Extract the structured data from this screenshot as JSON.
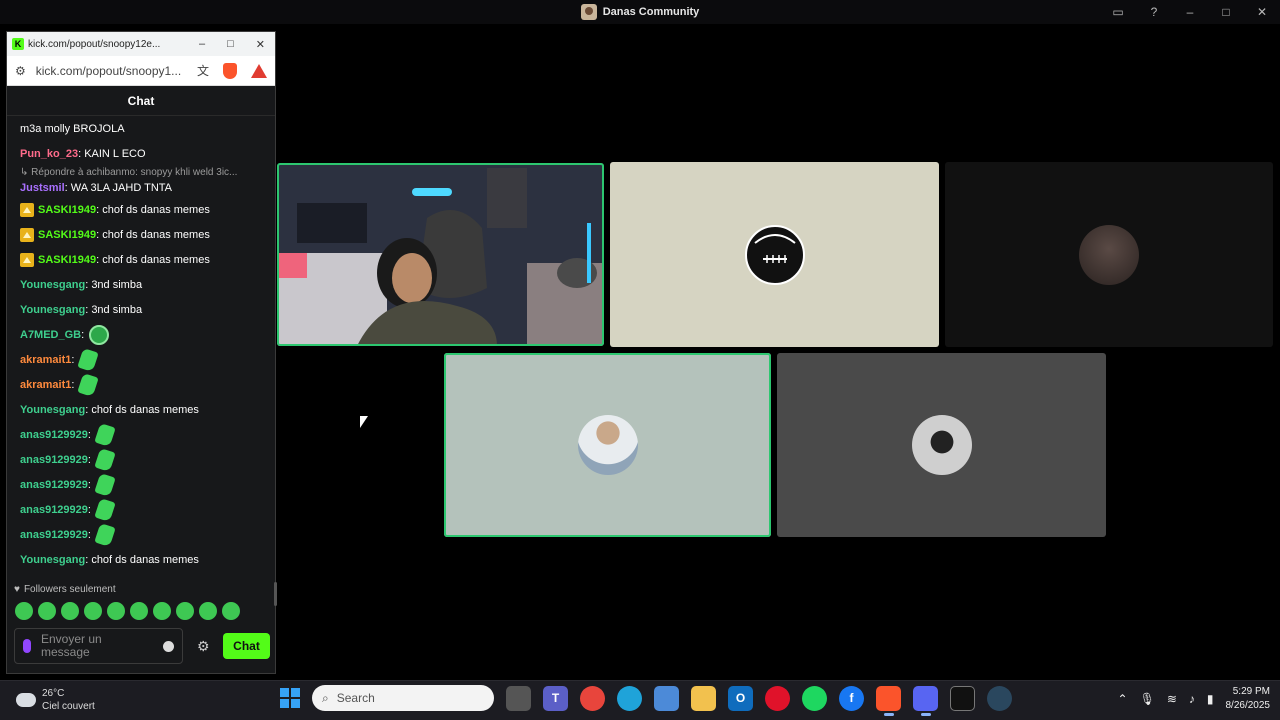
{
  "window": {
    "title": "Danas Community"
  },
  "popout": {
    "title": "kick.com/popout/snoopy12e...",
    "url": "kick.com/popout/snoopy1...",
    "chat_header": "Chat",
    "followers_label": "Followers seulement",
    "input_placeholder_line1": "Envoyer un",
    "input_placeholder_line2": "message",
    "send_label": "Chat"
  },
  "chat": {
    "messages": [
      {
        "user": "",
        "text": "m3a molly BROJOLA",
        "color": "#ffffff"
      },
      {
        "user": "Pun_ko_23",
        "text": ": KAIN L ECO",
        "color": "#ff6b8b"
      },
      {
        "reply": "Répondre à achibanmo: snopyy khli weld 3ic..."
      },
      {
        "user": "Justsmil",
        "text": ": WA 3LA JAHD TNTA",
        "color": "#a970ff"
      },
      {
        "user": "SASKI1949",
        "text": ": chof ds danas memes",
        "color": "#53fc18",
        "crown": true
      },
      {
        "user": "SASKI1949",
        "text": ": chof ds danas memes",
        "color": "#53fc18",
        "crown": true
      },
      {
        "user": "SASKI1949",
        "text": ": chof ds danas memes",
        "color": "#53fc18",
        "crown": true
      },
      {
        "user": "Younesgang",
        "text": ": 3nd simba",
        "color": "#3ecf8e"
      },
      {
        "user": "Younesgang",
        "text": ": 3nd simba",
        "color": "#3ecf8e"
      },
      {
        "user": "A7MED_GB",
        "text": ":",
        "color": "#3ecf8e",
        "emote": "round"
      },
      {
        "user": "akramait1",
        "text": ":",
        "color": "#ff8a3d",
        "emote": "leaf"
      },
      {
        "user": "akramait1",
        "text": ":",
        "color": "#ff8a3d",
        "emote": "leaf"
      },
      {
        "user": "Younesgang",
        "text": ": chof ds danas memes",
        "color": "#3ecf8e"
      },
      {
        "user": "anas9129929",
        "text": ":",
        "color": "#3ecf8e",
        "emote": "leaf"
      },
      {
        "user": "anas9129929",
        "text": ":",
        "color": "#3ecf8e",
        "emote": "leaf"
      },
      {
        "user": "anas9129929",
        "text": ":",
        "color": "#3ecf8e",
        "emote": "leaf"
      },
      {
        "user": "anas9129929",
        "text": ":",
        "color": "#3ecf8e",
        "emote": "leaf"
      },
      {
        "user": "anas9129929",
        "text": ":",
        "color": "#3ecf8e",
        "emote": "leaf"
      },
      {
        "user": "Younesgang",
        "text": ": chof ds danas memes",
        "color": "#3ecf8e"
      }
    ]
  },
  "taskbar": {
    "temperature": "26°C",
    "weather": "Ciel couvert",
    "search_placeholder": "Search",
    "time": "5:29 PM",
    "date": "8/26/2025"
  }
}
